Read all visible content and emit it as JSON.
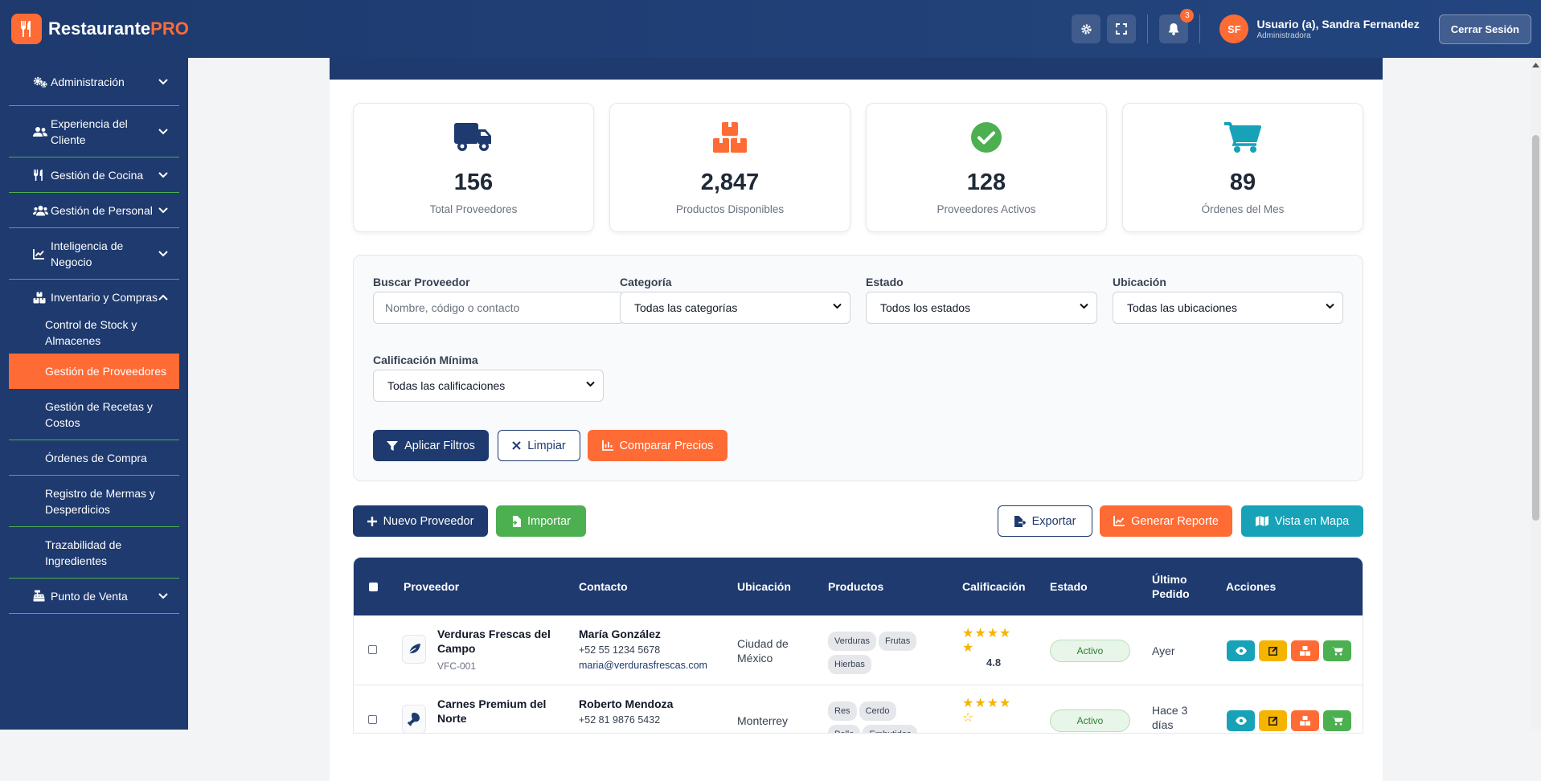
{
  "app": {
    "brand_main": "Restaurante",
    "brand_pro": "PRO"
  },
  "header": {
    "notifications_count": "3",
    "user_initials": "SF",
    "user_name": "Usuario (a), Sandra Fernandez",
    "user_role": "Administradora",
    "logout_label": "Cerrar Sesión",
    "icons": [
      "settings-icon",
      "fullscreen-icon",
      "bell-icon"
    ]
  },
  "sidebar": {
    "items": [
      {
        "label": "Administración",
        "icon": "cogs-icon"
      },
      {
        "label": "Experiencia del Cliente",
        "icon": "users-icon"
      },
      {
        "label": "Gestión de Cocina",
        "icon": "utensils-icon"
      },
      {
        "label": "Gestión de Personal",
        "icon": "team-icon"
      },
      {
        "label": "Inteligencia de Negocio",
        "icon": "chart-line-icon"
      },
      {
        "label": "Inventario y Compras",
        "icon": "boxes-icon",
        "expanded": true
      },
      {
        "label": "Punto de Venta",
        "icon": "cash-register-icon"
      }
    ],
    "sub_items": [
      {
        "label": "Control de Stock y Almacenes"
      },
      {
        "label": "Gestión de Proveedores",
        "active": true
      },
      {
        "label": "Gestión de Recetas y Costos"
      },
      {
        "label": "Órdenes de Compra"
      },
      {
        "label": "Registro de Mermas y Desperdicios"
      },
      {
        "label": "Trazabilidad de Ingredientes"
      }
    ]
  },
  "stats": [
    {
      "value": "156",
      "label": "Total Proveedores",
      "icon": "truck-icon",
      "color": "#1e3a6e"
    },
    {
      "value": "2,847",
      "label": "Productos Disponibles",
      "icon": "boxes-icon",
      "color": "#ff6b35"
    },
    {
      "value": "128",
      "label": "Proveedores Activos",
      "icon": "check-circle-icon",
      "color": "#4caf50"
    },
    {
      "value": "89",
      "label": "Órdenes del Mes",
      "icon": "cart-icon",
      "color": "#17a2b8"
    }
  ],
  "filters": {
    "search_label": "Buscar Proveedor",
    "search_placeholder": "Nombre, código o contacto",
    "category_label": "Categoría",
    "category_value": "Todas las categorías",
    "status_label": "Estado",
    "status_value": "Todos los estados",
    "location_label": "Ubicación",
    "location_value": "Todas las ubicaciones",
    "rating_label": "Calificación Mínima",
    "rating_value": "Todas las calificaciones",
    "apply_label": "Aplicar Filtros",
    "clear_label": "Limpiar",
    "compare_label": "Comparar Precios"
  },
  "actions": {
    "new_label": "Nuevo Proveedor",
    "import_label": "Importar",
    "export_label": "Exportar",
    "report_label": "Generar Reporte",
    "map_label": "Vista en Mapa"
  },
  "table": {
    "headers": [
      "Proveedor",
      "Contacto",
      "Ubicación",
      "Productos",
      "Calificación",
      "Estado",
      "Último Pedido",
      "Acciones"
    ],
    "rows": [
      {
        "name": "Verduras Frescas del Campo",
        "code": "VFC-001",
        "contact": "María González",
        "phone": "+52 55 1234 5678",
        "email": "maria@verdurasfrescas.com",
        "location": "Ciudad de México",
        "products": [
          "Verduras",
          "Frutas",
          "Hierbas"
        ],
        "stars": "★★★★★",
        "rating": "4.8",
        "status": "Activo",
        "last_order": "Ayer"
      },
      {
        "name": "Carnes Premium del Norte",
        "code": "",
        "contact": "Roberto Mendoza",
        "phone": "+52 81 9876 5432",
        "email": "",
        "location": "Monterrey",
        "products": [
          "Res",
          "Cerdo",
          "Pollo",
          "Embutidos"
        ],
        "stars": "★★★★☆",
        "rating": "",
        "status": "Activo",
        "last_order": "Hace 3 días"
      }
    ]
  },
  "colors": {
    "primary": "#1e3a6e",
    "accent": "#ff6b35",
    "success": "#4caf50",
    "info": "#17a2b8",
    "warning": "#f5b400"
  }
}
